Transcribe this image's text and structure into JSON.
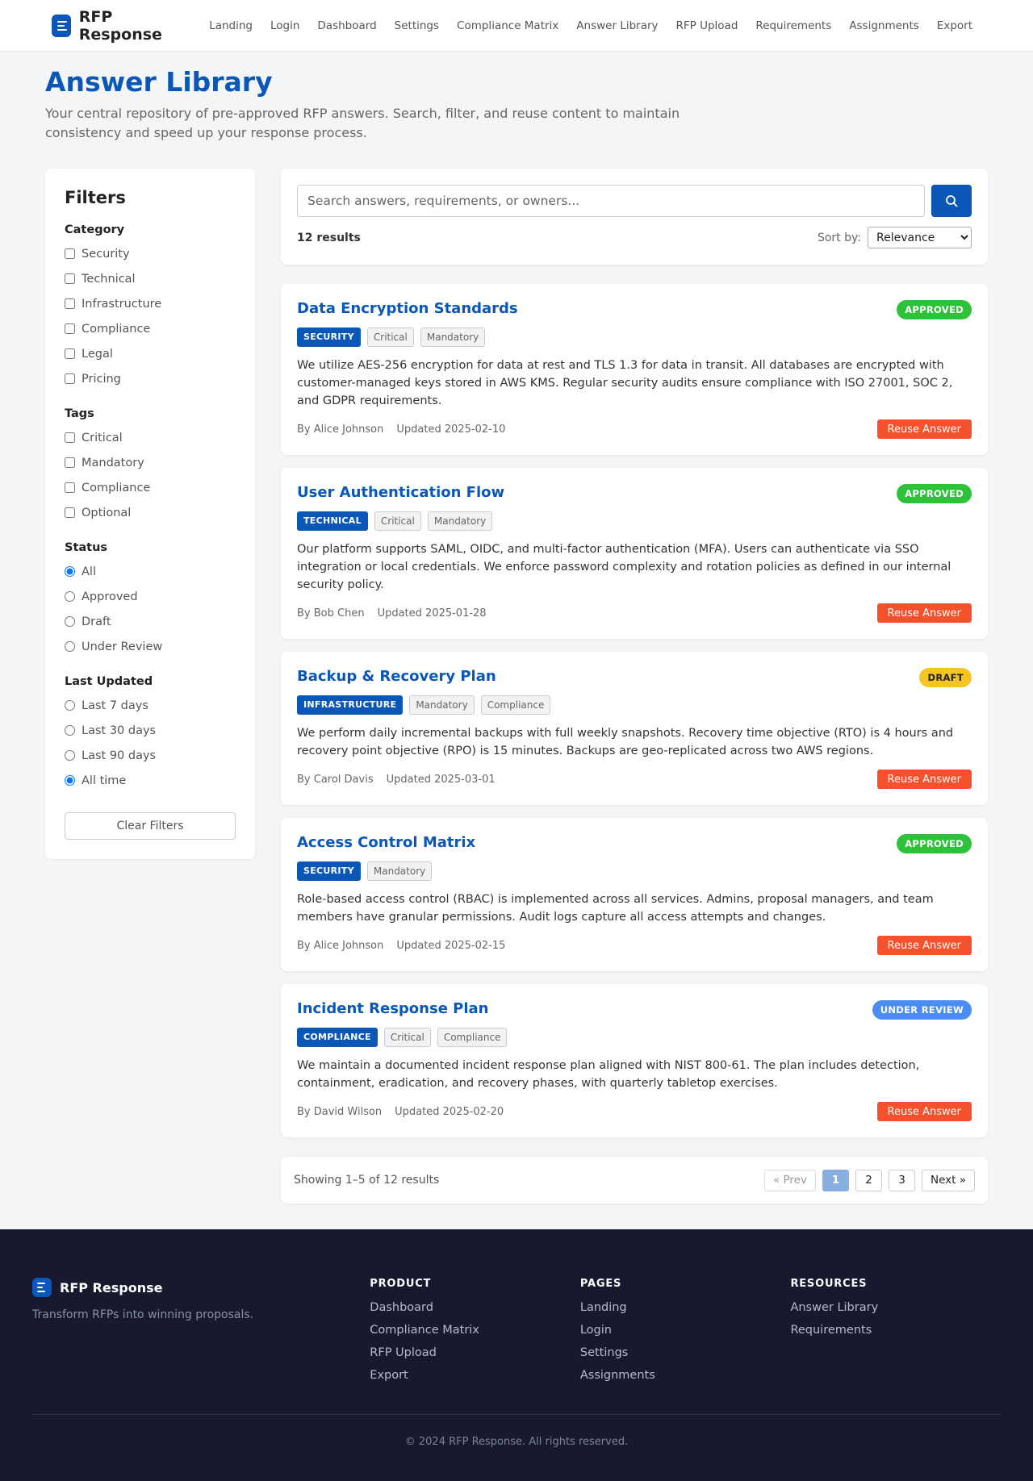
{
  "brand": {
    "name": "RFP Response",
    "logo_icon": "document-lines-icon",
    "accent": "#0a57b8"
  },
  "nav": [
    "Landing",
    "Login",
    "Dashboard",
    "Settings",
    "Compliance Matrix",
    "Answer Library",
    "RFP Upload",
    "Requirements",
    "Assignments",
    "Export"
  ],
  "page": {
    "title": "Answer Library",
    "subtitle": "Your central repository of pre-approved RFP answers. Search, filter, and reuse content to maintain consistency and speed up your response process."
  },
  "filters": {
    "heading": "Filters",
    "category": {
      "label": "Category",
      "options": [
        "Security",
        "Technical",
        "Infrastructure",
        "Compliance",
        "Legal",
        "Pricing"
      ]
    },
    "tags": {
      "label": "Tags",
      "options": [
        "Critical",
        "Mandatory",
        "Compliance",
        "Optional"
      ]
    },
    "status": {
      "label": "Status",
      "options": [
        "All",
        "Approved",
        "Draft",
        "Under Review"
      ],
      "selected": "All"
    },
    "last_updated": {
      "label": "Last Updated",
      "options": [
        "Last 7 days",
        "Last 30 days",
        "Last 90 days",
        "All time"
      ],
      "selected": "All time"
    },
    "clear_label": "Clear Filters"
  },
  "search": {
    "placeholder": "Search answers, requirements, or owners...",
    "value": "",
    "button_icon": "search-icon",
    "results_count": "12 results",
    "sort_label": "Sort by:",
    "sort_value": "Relevance"
  },
  "answers": [
    {
      "title": "Data Encryption Standards",
      "status": "APPROVED",
      "status_class": "approved",
      "category": "SECURITY",
      "tags": [
        "Critical",
        "Mandatory"
      ],
      "body": "We utilize AES-256 encryption for data at rest and TLS 1.3 for data in transit. All databases are encrypted with customer-managed keys stored in AWS KMS. Regular security audits ensure compliance with ISO 27001, SOC 2, and GDPR requirements.",
      "author": "By Alice Johnson",
      "updated": "Updated 2025-02-10",
      "action": "Reuse Answer"
    },
    {
      "title": "User Authentication Flow",
      "status": "APPROVED",
      "status_class": "approved",
      "category": "TECHNICAL",
      "tags": [
        "Critical",
        "Mandatory"
      ],
      "body": "Our platform supports SAML, OIDC, and multi-factor authentication (MFA). Users can authenticate via SSO integration or local credentials. We enforce password complexity and rotation policies as defined in our internal security policy.",
      "author": "By Bob Chen",
      "updated": "Updated 2025-01-28",
      "action": "Reuse Answer"
    },
    {
      "title": "Backup & Recovery Plan",
      "status": "DRAFT",
      "status_class": "draft",
      "category": "INFRASTRUCTURE",
      "tags": [
        "Mandatory",
        "Compliance"
      ],
      "body": "We perform daily incremental backups with full weekly snapshots. Recovery time objective (RTO) is 4 hours and recovery point objective (RPO) is 15 minutes. Backups are geo-replicated across two AWS regions.",
      "author": "By Carol Davis",
      "updated": "Updated 2025-03-01",
      "action": "Reuse Answer"
    },
    {
      "title": "Access Control Matrix",
      "status": "APPROVED",
      "status_class": "approved",
      "category": "SECURITY",
      "tags": [
        "Mandatory"
      ],
      "body": "Role-based access control (RBAC) is implemented across all services. Admins, proposal managers, and team members have granular permissions. Audit logs capture all access attempts and changes.",
      "author": "By Alice Johnson",
      "updated": "Updated 2025-02-15",
      "action": "Reuse Answer"
    },
    {
      "title": "Incident Response Plan",
      "status": "UNDER REVIEW",
      "status_class": "review",
      "category": "COMPLIANCE",
      "tags": [
        "Critical",
        "Compliance"
      ],
      "body": "We maintain a documented incident response plan aligned with NIST 800-61. The plan includes detection, containment, eradication, and recovery phases, with quarterly tabletop exercises.",
      "author": "By David Wilson",
      "updated": "Updated 2025-02-20",
      "action": "Reuse Answer"
    }
  ],
  "pagination": {
    "info": "Showing 1–5 of 12 results",
    "prev": "« Prev",
    "pages": [
      "1",
      "2",
      "3"
    ],
    "current": "1",
    "next": "Next »"
  },
  "footer": {
    "brand": "RFP Response",
    "tagline": "Transform RFPs into winning proposals.",
    "columns": [
      {
        "heading": "PRODUCT",
        "links": [
          "Dashboard",
          "Compliance Matrix",
          "RFP Upload",
          "Export"
        ]
      },
      {
        "heading": "PAGES",
        "links": [
          "Landing",
          "Login",
          "Settings",
          "Assignments"
        ]
      },
      {
        "heading": "RESOURCES",
        "links": [
          "Answer Library",
          "Requirements"
        ]
      }
    ],
    "copyright": "© 2024 RFP Response. All rights reserved."
  },
  "colors": {
    "approved": "#2ec13a",
    "draft": "#f5c623",
    "review": "#4a8cf2",
    "reuse": "#f4512c",
    "footer_bg": "#171a2e"
  }
}
